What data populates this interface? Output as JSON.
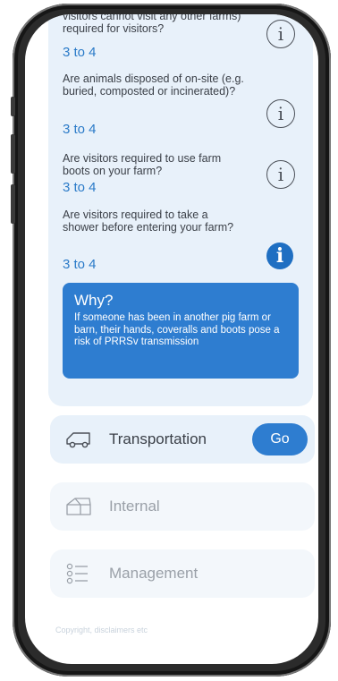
{
  "questions": [
    {
      "text": "visitors cannot visit any other farms) required for visitors?",
      "answer": "3 to 4"
    },
    {
      "text": "Are animals disposed of on-site (e.g. buried, composted or incinerated)?",
      "answer": "3 to 4"
    },
    {
      "text": "Are visitors required to use farm boots on your farm?",
      "answer": "3 to 4"
    },
    {
      "text": "Are visitors required to take a shower before entering your farm?",
      "answer": "3 to 4"
    }
  ],
  "why": {
    "title": "Why?",
    "text": "If someone has been in another pig farm or barn, their hands, coveralls and boots pose a risk of PRRSv transmission"
  },
  "sections": [
    {
      "label": "Transportation",
      "icon": "van-icon",
      "action": "Go"
    },
    {
      "label": "Internal",
      "icon": "barn-icon"
    },
    {
      "label": "Management",
      "icon": "list-icon"
    }
  ],
  "footer": {
    "copyright": "Copyright, disclaimers etc"
  },
  "colors": {
    "accent": "#2e7dd0",
    "card_bg": "#e8f1fa",
    "answer_text": "#2a7ac8"
  }
}
